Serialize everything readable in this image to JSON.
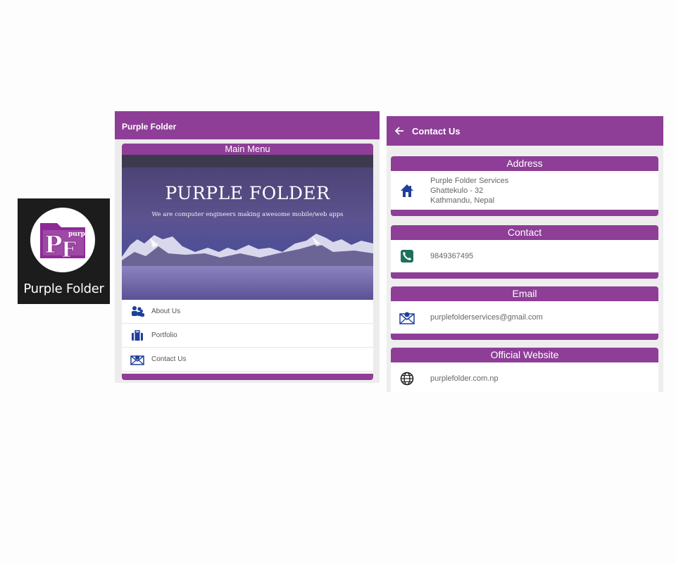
{
  "app_icon": {
    "logo_text": "PF",
    "logo_small": "purple",
    "label": "Purple Folder"
  },
  "main_screen": {
    "appbar_title": "Purple Folder",
    "menu_header": "Main Menu",
    "banner": {
      "title": "PURPLE FOLDER",
      "subtitle": "We are computer engineers making awesome mobile/web apps"
    },
    "items": [
      {
        "label": "About Us",
        "icon": "people-icon"
      },
      {
        "label": "Portfolio",
        "icon": "briefcase-icon"
      },
      {
        "label": "Contact Us",
        "icon": "envelope-icon"
      }
    ]
  },
  "contact_screen": {
    "appbar_title": "Contact Us",
    "sections": [
      {
        "heading": "Address",
        "icon": "home-icon",
        "lines": [
          "Purple Folder Services",
          "Ghattekulo - 32",
          "Kathmandu, Nepal"
        ]
      },
      {
        "heading": "Contact",
        "icon": "phone-icon",
        "lines": [
          "9849367495"
        ]
      },
      {
        "heading": "Email",
        "icon": "envelope-icon",
        "lines": [
          "purplefolderservices@gmail.com"
        ]
      },
      {
        "heading": "Official Website",
        "icon": "globe-icon",
        "lines": [
          "purplefolder.com.np"
        ]
      }
    ]
  },
  "colors": {
    "primary": "#8e3e97",
    "icon_blue": "#1e3f9c",
    "background": "#eeeeee"
  }
}
